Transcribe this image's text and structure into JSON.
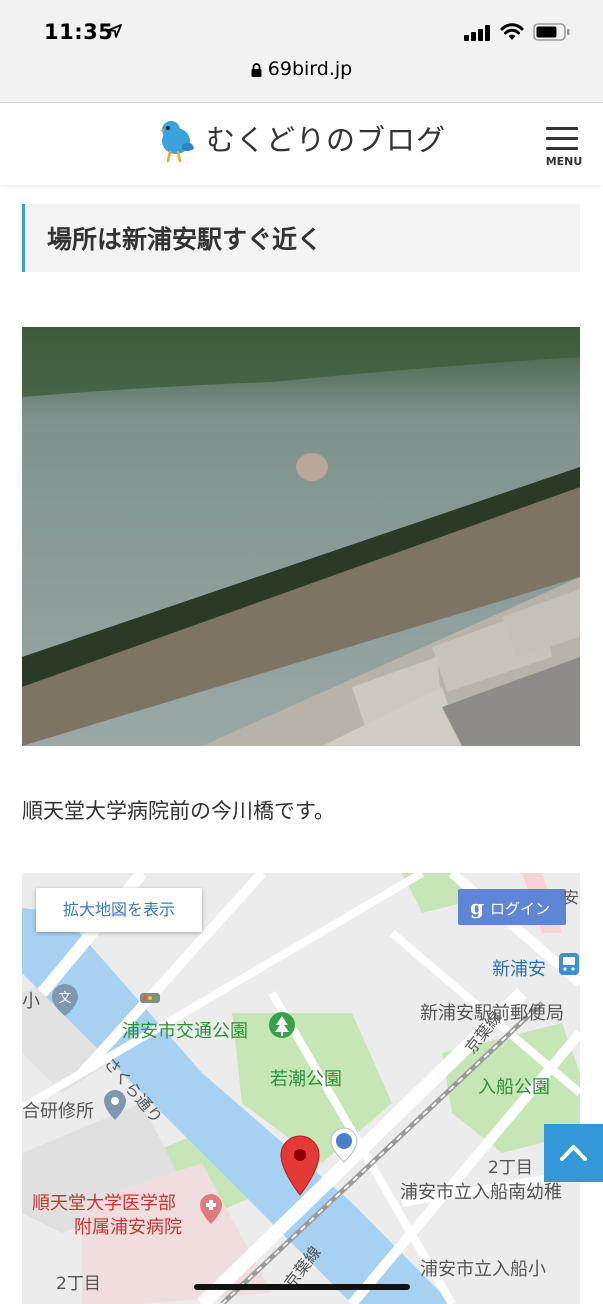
{
  "status_bar": {
    "time": "11:35",
    "url": "69bird.jp"
  },
  "site": {
    "title": "むくどりのブログ",
    "menu_label": "MENU"
  },
  "article": {
    "heading": "場所は新浦安駅すぐ近く",
    "caption": "順天堂大学病院前の今川橋です。"
  },
  "map": {
    "enlarge_button": "拡大地図を表示",
    "login_button": "ログイン",
    "labels": {
      "station": "新浦安",
      "post_office": "新浦安駅前郵便局",
      "park_kotsu": "浦安市交通公園",
      "park_wakashio": "若潮公園",
      "park_irifune": "入船公園",
      "railway_keiyo_1": "京葉線",
      "railway_keiyo_2": "京葉線",
      "sakura_street": "さくら通り",
      "training": "合研修所",
      "school_small": "小",
      "hospital_line1": "順天堂大学医学部",
      "hospital_line2": "附属浦安病院",
      "chome_2_right": "2丁目",
      "chome_2_left": "2丁目",
      "kindergarten": "浦安市立入船南幼稚",
      "school_irifune": "浦安市立入船小",
      "an_edge": "安"
    }
  },
  "colors": {
    "accent": "#3ba0d8",
    "to_top": "#3498d8",
    "water": "#a8d0f0",
    "park": "#c4e4b0",
    "pin": "#e53935"
  }
}
